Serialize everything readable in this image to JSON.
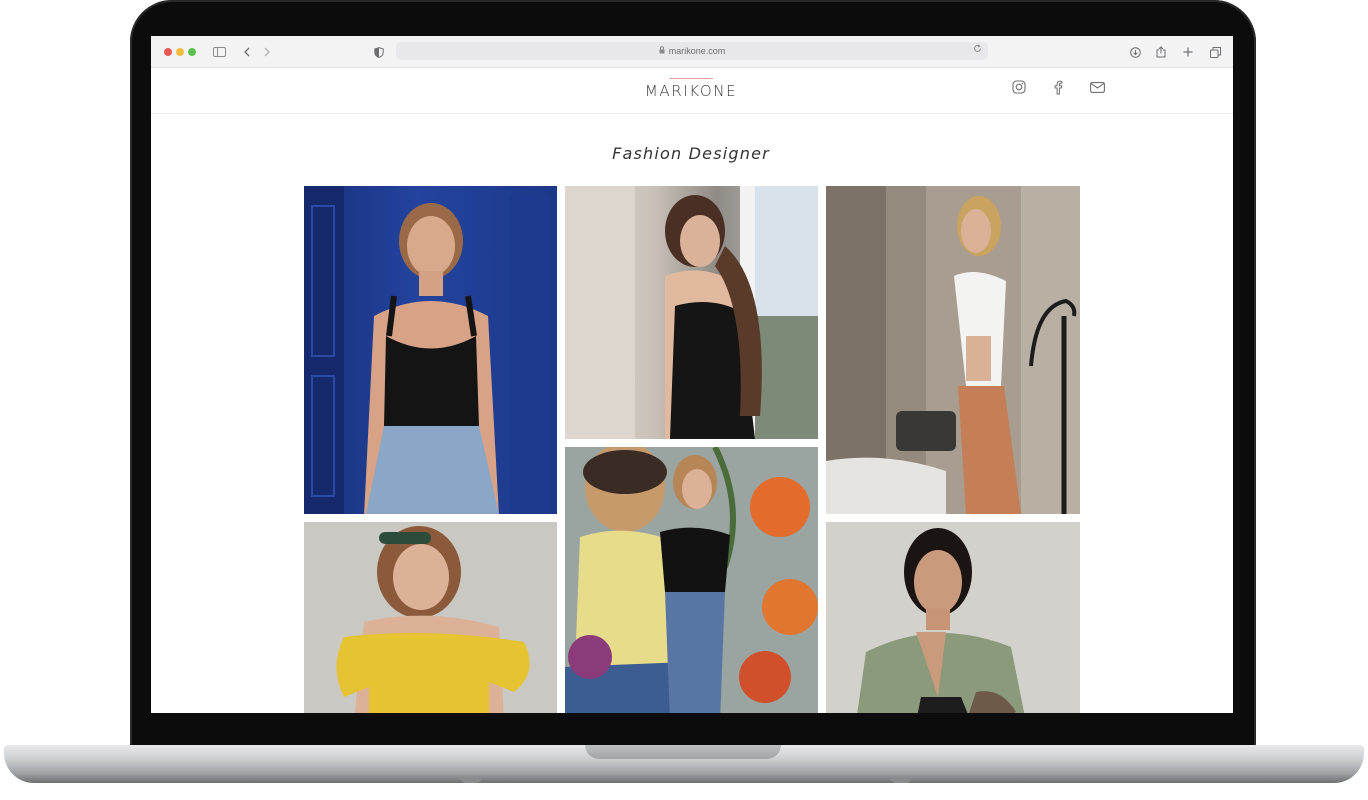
{
  "browser": {
    "url": "marikone.com"
  },
  "header": {
    "logo": "MARIKONE",
    "social": [
      "instagram-icon",
      "facebook-icon",
      "mail-icon"
    ]
  },
  "main": {
    "heading": "Fashion Designer"
  },
  "gallery": {
    "photos": [
      "woman-in-black-bustier-blue-door",
      "woman-in-black-corset-by-window",
      "woman-in-white-shirt-orange-trousers",
      "woman-in-yellow-off-shoulder-top",
      "woman-in-front-of-floral-mural",
      "woman-in-green-blazer"
    ]
  },
  "colors": {
    "accent": "#e6a2a2",
    "logo_text": "#3a3a3a"
  }
}
